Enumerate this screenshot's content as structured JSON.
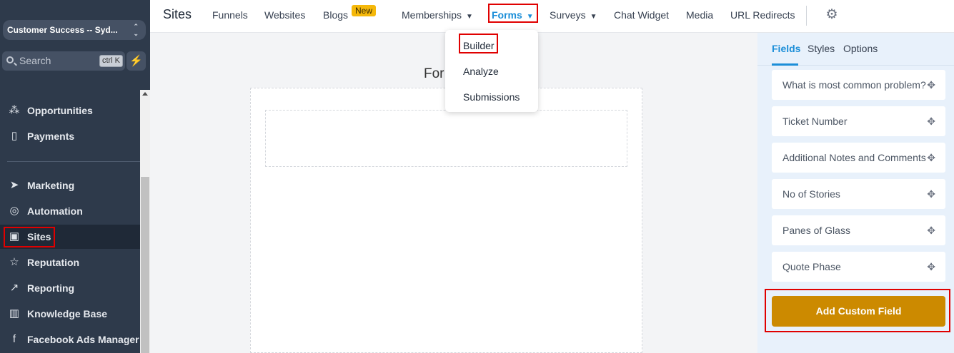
{
  "sidebar": {
    "account": "Customer Success -- Syd...",
    "search": {
      "placeholder": "Search",
      "shortcut": "ctrl K"
    },
    "items": [
      {
        "label": "Opportunities",
        "icon": "opportunities-icon",
        "glyph": "⁂"
      },
      {
        "label": "Payments",
        "icon": "payments-icon",
        "glyph": "▯"
      },
      {
        "label": "Marketing",
        "icon": "send-icon",
        "glyph": "➤"
      },
      {
        "label": "Automation",
        "icon": "automation-icon",
        "glyph": "◎"
      },
      {
        "label": "Sites",
        "icon": "sites-icon",
        "glyph": "▣"
      },
      {
        "label": "Reputation",
        "icon": "star-icon",
        "glyph": "☆"
      },
      {
        "label": "Reporting",
        "icon": "trend-icon",
        "glyph": "↗"
      },
      {
        "label": "Knowledge Base",
        "icon": "book-icon",
        "glyph": "▥"
      },
      {
        "label": "Facebook Ads Manager",
        "icon": "facebook-icon",
        "glyph": "f"
      }
    ]
  },
  "topnav": {
    "title": "Sites",
    "items": {
      "funnels": "Funnels",
      "websites": "Websites",
      "blogs": "Blogs",
      "blogs_badge": "New",
      "memberships": "Memberships",
      "forms": "Forms",
      "surveys": "Surveys",
      "chat_widget": "Chat Widget",
      "media": "Media",
      "url_redirects": "URL Redirects"
    }
  },
  "forms_menu": [
    "Builder",
    "Analyze",
    "Submissions"
  ],
  "canvas": {
    "title_visible": "For"
  },
  "panel": {
    "tabs": [
      "Fields",
      "Styles",
      "Options"
    ],
    "fields": [
      "What is most common problem?",
      "Ticket Number",
      "Additional Notes and Comments",
      "No of Stories",
      "Panes of Glass",
      "Quote Phase"
    ],
    "add_button": "Add Custom Field"
  },
  "colors": {
    "sidebar_bg": "#2e3a4b",
    "accent_blue": "#1b8ed8",
    "add_button": "#cc8a00",
    "highlight_red": "#e00000"
  }
}
